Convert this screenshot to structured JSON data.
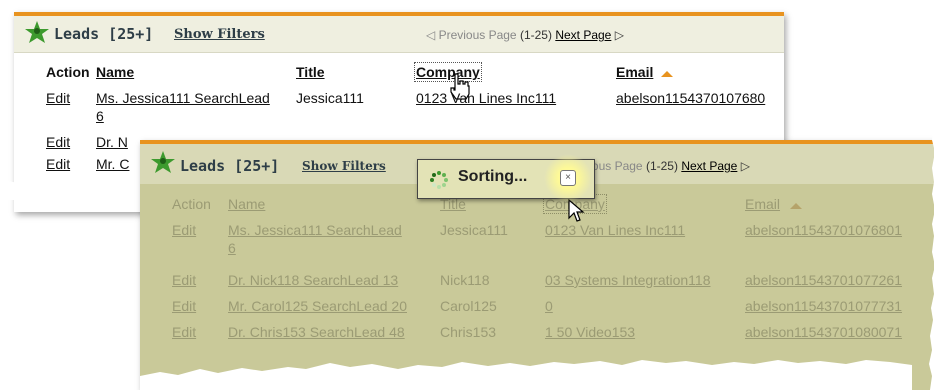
{
  "leads_title": "Leads [25+]",
  "show_filters": "Show Filters",
  "pager": {
    "prev": "◁ Previous Page",
    "range": "(1-25)",
    "next": "Next Page",
    "next_arrow": "▷"
  },
  "columns": {
    "action": "Action",
    "name": "Name",
    "title": "Title",
    "company": "Company",
    "email": "Email"
  },
  "rows_top": [
    {
      "action": "Edit",
      "name": "Ms. Jessica111 SearchLead",
      "name2": "6",
      "title": "Jessica111",
      "company": "0123 Van Lines Inc111",
      "email": "abelson1154370107680"
    },
    {
      "action": "Edit",
      "name": "Dr. N"
    },
    {
      "action": "Edit",
      "name": "Mr. C"
    }
  ],
  "rows_overlay": [
    {
      "action": "Edit",
      "name": "Ms. Jessica111 SearchLead",
      "name2": "6",
      "title": "Jessica111",
      "company": "0123 Van Lines Inc111",
      "email": "abelson11543701076801"
    },
    {
      "action": "Edit",
      "name": "Dr. Nick118 SearchLead 13",
      "title": "Nick118",
      "company": "03 Systems Integration118",
      "email": "abelson11543701077261"
    },
    {
      "action": "Edit",
      "name": "Mr. Carol125 SearchLead 20",
      "title": "Carol125",
      "company": "0",
      "email": "abelson11543701077731"
    },
    {
      "action": "Edit",
      "name": "Dr. Chris153 SearchLead 48",
      "title": "Chris153",
      "company": "1 50 Video153",
      "email": "abelson11543701080071"
    }
  ],
  "sorting": {
    "label": "Sorting...",
    "close": "×"
  },
  "colors": {
    "accent": "#e8931f",
    "header_bg": "#efefe0",
    "overlay_bg": "#c9c999",
    "text": "#2e3e47"
  },
  "icons": [
    "star-person-logo-icon",
    "hand-cursor-icon",
    "arrow-cursor-icon",
    "sort-arrow-up-icon",
    "spinner-icon",
    "close-icon"
  ]
}
